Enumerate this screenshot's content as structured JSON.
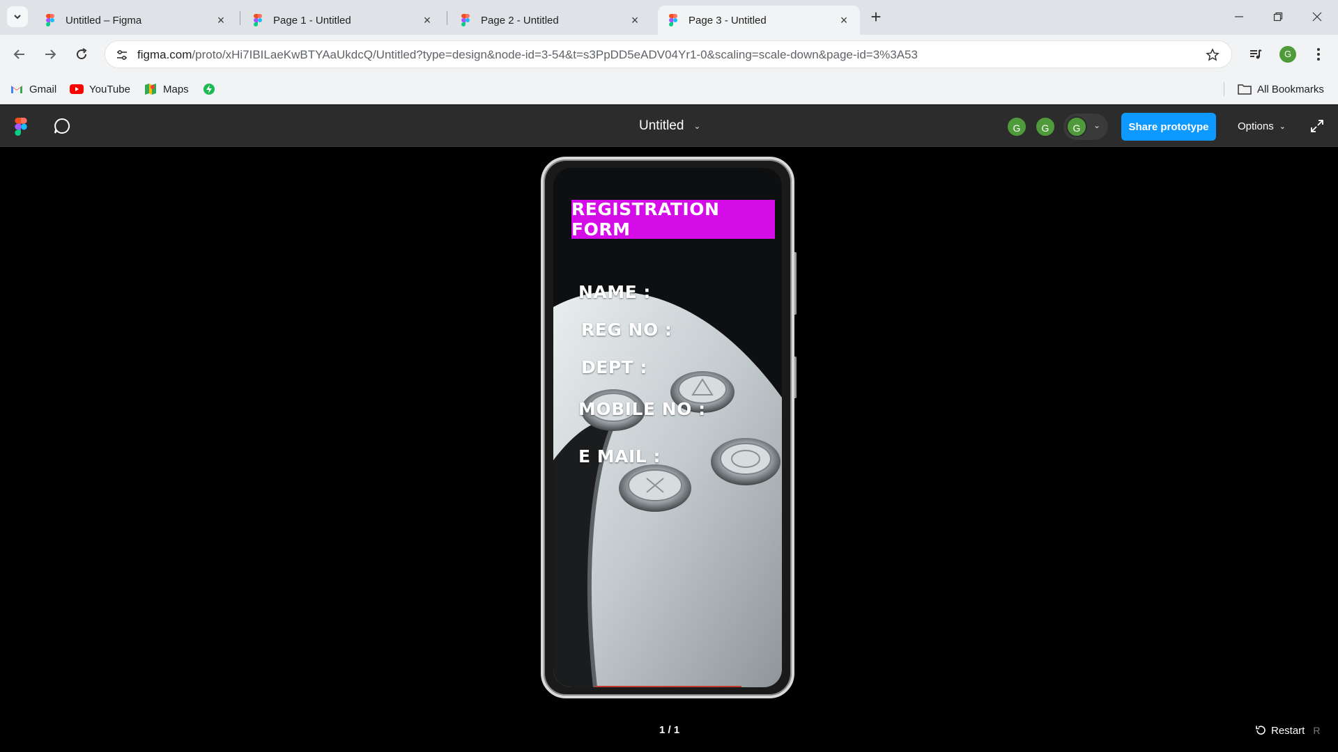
{
  "browser": {
    "tabs": [
      {
        "title": "Untitled – Figma",
        "active": false
      },
      {
        "title": "Page 1 - Untitled",
        "active": false
      },
      {
        "title": "Page 2 - Untitled",
        "active": false
      },
      {
        "title": "Page 3 - Untitled",
        "active": true
      }
    ],
    "url": {
      "host": "figma.com",
      "path": "/proto/xHi7IBILaeKwBTYAaUkdcQ/Untitled?type=design&node-id=3-54&t=s3PpDD5eADV04Yr1-0&scaling=scale-down&page-id=3%3A53"
    },
    "profile_initial": "G",
    "bookmarks": [
      {
        "label": "Gmail",
        "icon": "gmail-icon"
      },
      {
        "label": "YouTube",
        "icon": "youtube-icon"
      },
      {
        "label": "Maps",
        "icon": "maps-icon"
      },
      {
        "label": "",
        "icon": "bolt-extension-icon"
      }
    ],
    "all_bookmarks_label": "All Bookmarks"
  },
  "figma": {
    "file_title": "Untitled",
    "collaborators": [
      "G",
      "G",
      "G"
    ],
    "share_label": "Share prototype",
    "options_label": "Options",
    "page_counter": "1 / 1",
    "restart_label": "Restart",
    "restart_shortcut": "R",
    "colors": {
      "share_button": "#0d99ff",
      "avatar": "#4f9a3a",
      "header_bg": "#2c2c2c"
    }
  },
  "prototype": {
    "form_title": "REGISTRATION FORM",
    "fields": [
      "NAME  :",
      "REG NO :",
      "DEPT :",
      "MOBILE NO :",
      "E MAIL :"
    ],
    "colors": {
      "title_bg": "#d40de8",
      "label_text": "#ffffff"
    }
  }
}
